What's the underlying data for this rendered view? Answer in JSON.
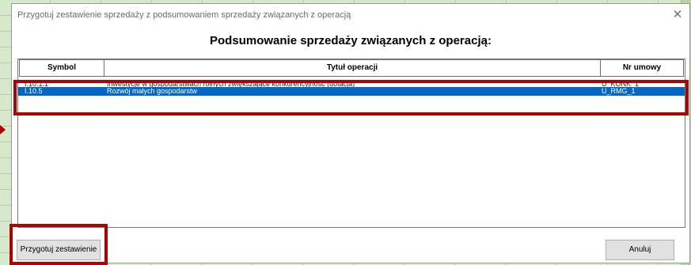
{
  "window": {
    "title": "Przygotuj zestawienie sprzedaży z podsumowaniem sprzedaży związanych z operacją",
    "close_glyph": "✕"
  },
  "heading": "Podsumowanie sprzedaży związanych z operacją:",
  "table": {
    "columns": [
      "Symbol",
      "Tytuł operacji",
      "Nr umowy"
    ],
    "rows": [
      {
        "symbol": "I.10.1.1",
        "title": "Inwestycje w gospodarstwach rolnych zwiększające konkurencyjność (dotacja)",
        "contract": "U_KONK_1",
        "selected": false
      },
      {
        "symbol": "I.10.5",
        "title": "Rozwój małych gospodarstw",
        "contract": "U_RMG_1",
        "selected": true
      }
    ]
  },
  "buttons": {
    "prepare": "Przygotuj zestawienie",
    "cancel": "Anuluj"
  },
  "colors": {
    "selection": "#0067c4",
    "highlight": "#b00000"
  }
}
